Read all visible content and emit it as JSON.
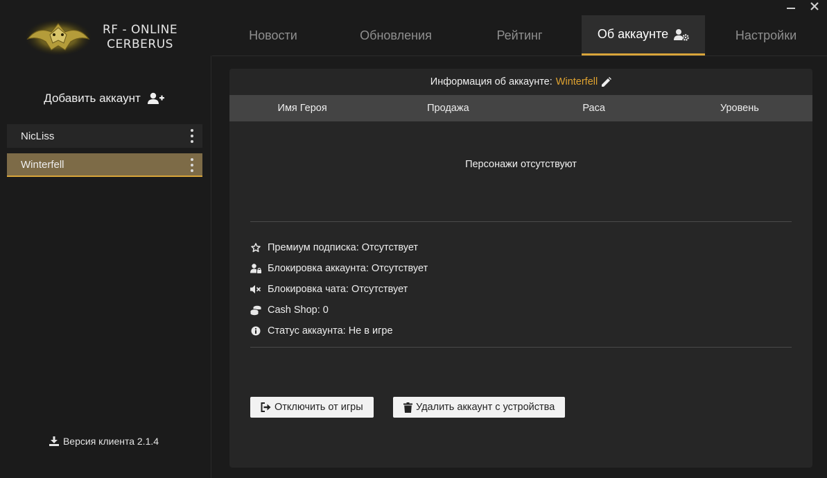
{
  "window": {
    "minimize_icon": "minimize-icon",
    "close_icon": "close-icon"
  },
  "logo": {
    "line1": "RF - ONLINE",
    "line2": "CERBERUS"
  },
  "nav": {
    "tabs": [
      {
        "label": "Новости"
      },
      {
        "label": "Обновления"
      },
      {
        "label": "Рейтинг"
      },
      {
        "label": "Об аккаунте",
        "active": true,
        "icon": "user-gear-icon"
      },
      {
        "label": "Настройки"
      }
    ]
  },
  "sidebar": {
    "add_account_label": "Добавить аккаунт",
    "accounts": [
      {
        "name": "NicLiss"
      },
      {
        "name": "Winterfell",
        "active": true
      }
    ],
    "version_label": "Версия клиента 2.1.4"
  },
  "panel": {
    "title_prefix": "Информация об аккаунте:",
    "account_name": "Winterfell",
    "columns": [
      "Имя Героя",
      "Продажа",
      "Раса",
      "Уровень"
    ],
    "empty_message": "Персонажи отсутствуют",
    "info": [
      {
        "icon": "star-icon",
        "text": "Премиум подписка: Отсутствует"
      },
      {
        "icon": "user-lock-icon",
        "text": "Блокировка аккаунта: Отсутствует"
      },
      {
        "icon": "volume-mute-icon",
        "text": "Блокировка чата: Отсутствует"
      },
      {
        "icon": "coins-icon",
        "text": "Cash Shop: 0"
      },
      {
        "icon": "info-icon",
        "text": "Статус аккаунта: Не в игре"
      }
    ],
    "disconnect_label": "Отключить от игры",
    "delete_label": "Удалить аккаунт с устройства"
  },
  "colors": {
    "accent": "#d9a53a",
    "account_name": "#e0a330",
    "active_account_bg": "#7d6b47"
  }
}
